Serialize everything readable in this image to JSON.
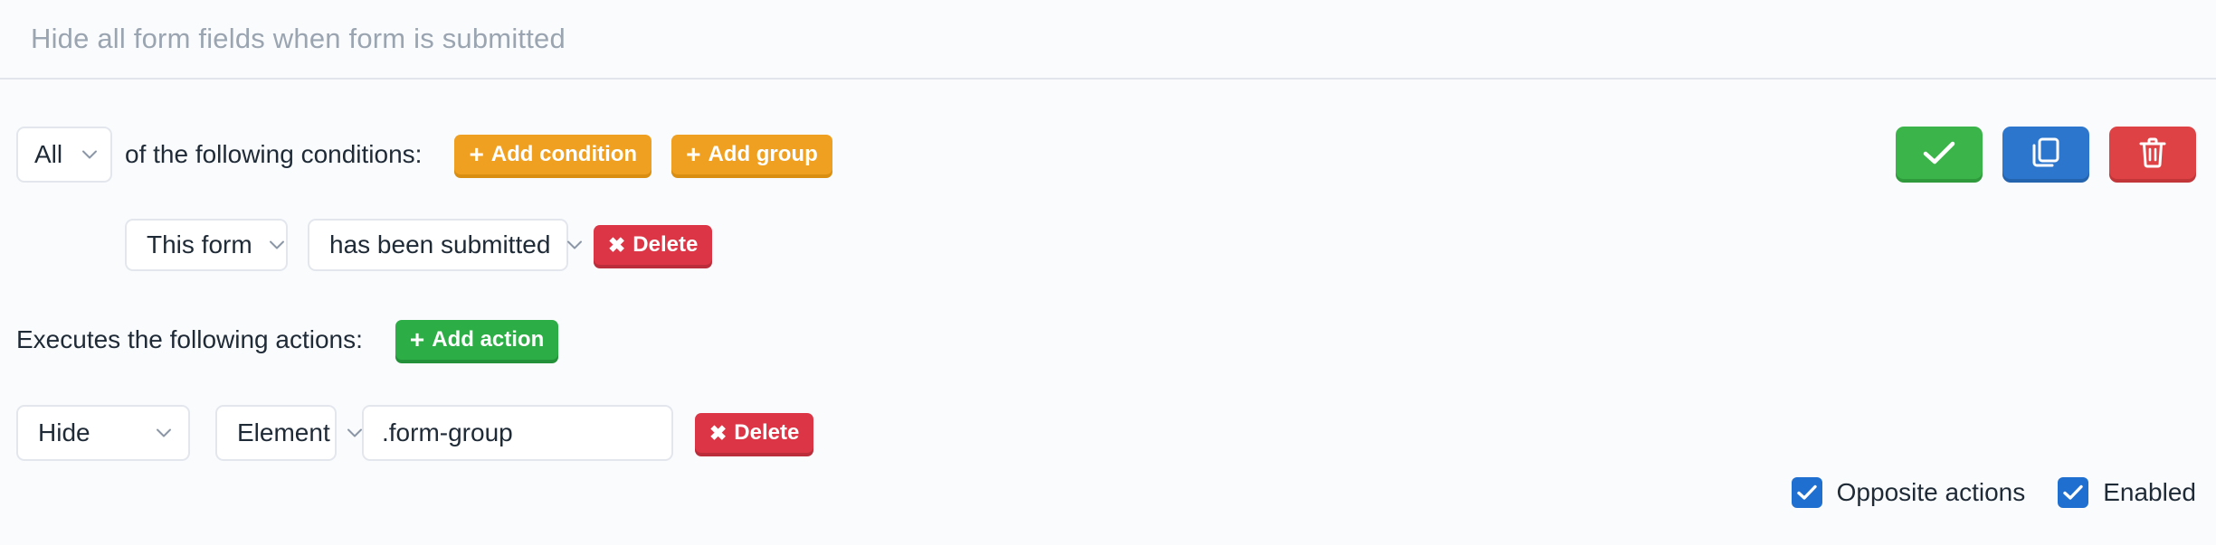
{
  "header": {
    "title": "Hide all form fields when form is submitted"
  },
  "conditions": {
    "match_select": {
      "value": "All",
      "icon": "chevron-down-icon"
    },
    "label": "of the following conditions:",
    "add_condition_label": "Add condition",
    "add_group_label": "Add group",
    "plus_glyph": "+",
    "items": [
      {
        "subject": "This form",
        "operator": "has been submitted",
        "delete_label": "Delete",
        "delete_glyph": "✖"
      }
    ]
  },
  "rule_actions": {
    "save_icon": "check-icon",
    "duplicate_icon": "copy-icon",
    "delete_icon": "trash-icon"
  },
  "actions": {
    "label": "Executes the following actions:",
    "add_action_label": "Add action",
    "plus_glyph": "+",
    "items": [
      {
        "type": "Hide",
        "target": "Element",
        "value": ".form-group",
        "value_placeholder": "",
        "delete_label": "Delete",
        "delete_glyph": "✖"
      }
    ]
  },
  "footer": {
    "opposite_actions_label": "Opposite actions",
    "opposite_actions_checked": true,
    "enabled_label": "Enabled",
    "enabled_checked": true
  },
  "colors": {
    "orange": "#f0a020",
    "green": "#2cad45",
    "red": "#dc3545",
    "blue": "#1f6fd0",
    "background": "#fafbfd",
    "title_gray": "#9aa5b1"
  }
}
